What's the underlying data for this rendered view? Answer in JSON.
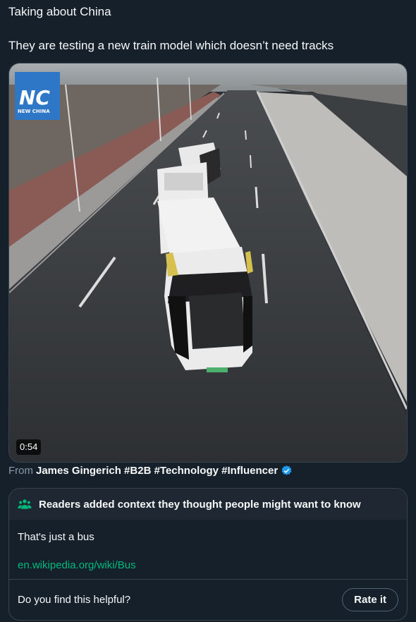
{
  "tweet": {
    "line1": "Taking about China",
    "line2": "They are testing a new train model which doesn’t need tracks"
  },
  "media": {
    "duration": "0:54",
    "logo_text": "NEW CHINA",
    "logo_icon": "xinhua-nc-logo"
  },
  "attribution": {
    "from_label": "From",
    "author": "James Gingerich #B2B #Technology #Influencer",
    "verified_color": "#1d9bf0"
  },
  "community_note": {
    "header": "Readers added context they thought people might want to know",
    "header_icon": "people-icon",
    "accent_color": "#00ba7c",
    "text": "That's just a bus",
    "link": "en.wikipedia.org/wiki/Bus",
    "question": "Do you find this helpful?",
    "rate_label": "Rate it"
  }
}
